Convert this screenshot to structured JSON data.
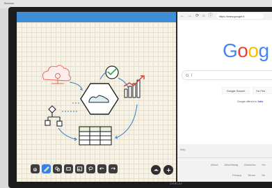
{
  "window": {
    "title": "Browser"
  },
  "device": {
    "brand": "OKBLAY"
  },
  "whiteboard": {
    "toolbar": [
      {
        "name": "hand-tool",
        "icon": "hand-icon",
        "active": false
      },
      {
        "name": "pen-tool",
        "icon": "pen-icon",
        "active": true
      },
      {
        "name": "shape-tool",
        "icon": "shapes-icon",
        "active": false
      },
      {
        "name": "eraser-tool",
        "icon": "eraser-icon",
        "active": false
      },
      {
        "name": "image-tool",
        "icon": "image-icon",
        "active": false
      },
      {
        "name": "lasso-tool",
        "icon": "lasso-icon",
        "active": false
      },
      {
        "name": "undo-tool",
        "icon": "undo-icon",
        "active": false
      },
      {
        "name": "redo-tool",
        "icon": "redo-icon",
        "active": false
      }
    ],
    "accent": "#3e8fd8"
  },
  "browser": {
    "nav": {
      "back": "←",
      "forward": "→",
      "reload": "⟳",
      "home": "⌂",
      "info": "ⓘ"
    },
    "url": "https://www.google.it",
    "logo": [
      "G",
      "o",
      "o",
      "g"
    ],
    "search_placeholder": "",
    "buttons": {
      "search": "Google Search",
      "lucky": "I'm Fee"
    },
    "offered_prefix": "Google offered in:",
    "offered_lang": "Italia",
    "footer": {
      "country": "Italy",
      "links_row1": [
        "About",
        "Advertising",
        "Business",
        "Ho"
      ],
      "links_row2": [
        "Privacy",
        "Terms",
        "Se"
      ]
    }
  }
}
